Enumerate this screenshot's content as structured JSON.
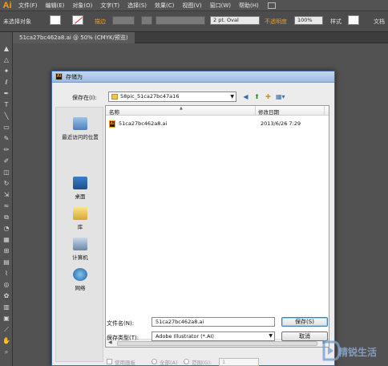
{
  "app": {
    "logo": "Ai"
  },
  "menu": [
    "文件(F)",
    "编辑(E)",
    "对象(O)",
    "文字(T)",
    "选择(S)",
    "效果(C)",
    "视图(V)",
    "窗口(W)",
    "帮助(H)"
  ],
  "control_bar": {
    "selection": "未选择对象",
    "stroke_label": "描边",
    "stroke_weight": "2 pt. Oval",
    "opacity_label": "不透明度",
    "opacity_value": "100%",
    "style_label": "样式",
    "doc_label": "文档"
  },
  "document_tab": "51ca27bc462a8.ai @ 50% (CMYK/预览)",
  "dialog": {
    "title": "存储为",
    "save_in_label": "保存在(I):",
    "save_in_value": "58pic_51ca27bc47a16",
    "places": [
      "最近访问的位置",
      "桌面",
      "库",
      "计算机",
      "网络"
    ],
    "columns": {
      "name": "名称",
      "modified": "修改日期"
    },
    "files": [
      {
        "name": "51ca27bc462a8.ai",
        "date": "2013/6/26 7:29"
      }
    ],
    "filename_label": "文件名(N):",
    "filename_value": "51ca27bc462a8.ai",
    "type_label": "保存类型(T):",
    "type_value": "Adobe Illustrator (*.AI)",
    "save_button": "保存(S)",
    "cancel_button": "取消",
    "use_artboards": "使用画板",
    "all": "全部(A)",
    "range": "范围(G):",
    "range_value": "1"
  },
  "watermark": "精锐生活"
}
